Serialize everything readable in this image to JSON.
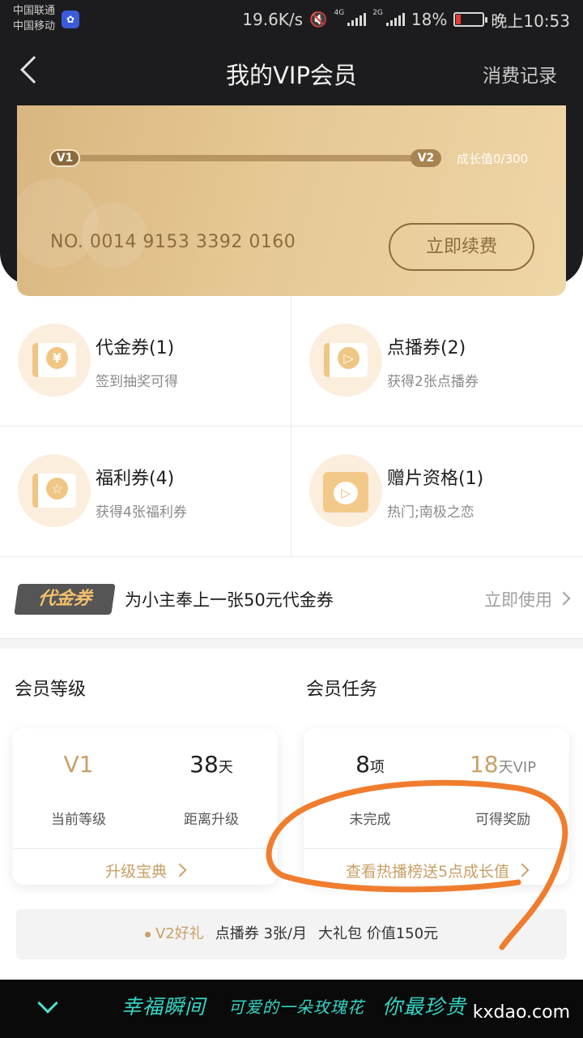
{
  "status_bar": {
    "carrier_1": "中国联通",
    "carrier_2": "中国移动",
    "net_speed": "19.6K/s",
    "sim1_tag": "4G",
    "sim2_tag": "2G",
    "battery": "18%",
    "battery_fraction": 0.18,
    "time": "晚上10:53"
  },
  "nav": {
    "title": "我的VIP会员",
    "right_link": "消费记录"
  },
  "vip_card": {
    "current_level": "V1",
    "next_level": "V2",
    "growth_text": "成长值0/300",
    "growth_progress": 0,
    "card_number": "NO. 0014 9153 3392 0160",
    "renew_label": "立即续费"
  },
  "coupons": [
    {
      "title": "代金券(1)",
      "subtitle": "签到抽奖可得",
      "icon": "voucher-icon",
      "glyph": "¥"
    },
    {
      "title": "点播券(2)",
      "subtitle": "获得2张点播券",
      "icon": "play-ticket-icon",
      "glyph": "▷"
    },
    {
      "title": "福利券(4)",
      "subtitle": "获得4张福利券",
      "icon": "star-ticket-icon",
      "glyph": "☆"
    },
    {
      "title": "赠片资格(1)",
      "subtitle": "热门;南极之恋",
      "icon": "gift-video-icon",
      "glyph": "▷"
    }
  ],
  "promo": {
    "badge": "代金券",
    "text": "为小主奉上一张50元代金券",
    "action": "立即使用"
  },
  "member_level": {
    "heading": "会员等级",
    "level_value": "V1",
    "level_label": "当前等级",
    "days_value": "38",
    "days_unit": "天",
    "days_label": "距离升级",
    "link": "升级宝典"
  },
  "member_tasks": {
    "heading": "会员任务",
    "count_value": "8",
    "count_unit": "项",
    "count_label": "未完成",
    "reward_value": "18",
    "reward_unit": "天VIP",
    "reward_label": "可得奖励",
    "link": "查看热播榜送5点成长值"
  },
  "gift_bar": {
    "level": "V2好礼",
    "item_1": "点播券 3张/月",
    "item_2": "大礼包 价值150元"
  },
  "bottom_bar": {
    "deco_1": "幸福瞬间",
    "deco_2": "可爱的一朵玫瑰花",
    "deco_3": "你最珍贵",
    "watermark": "kxdao.com"
  },
  "colors": {
    "accent_gold": "#c9a066",
    "dark_header": "#1c1c1e",
    "annotation": "#f07d2e"
  }
}
